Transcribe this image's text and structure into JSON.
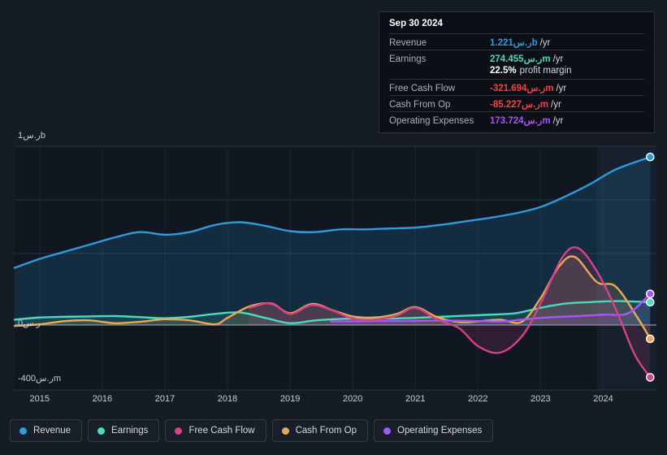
{
  "chart_data": {
    "type": "area",
    "title": "",
    "xlabel": "",
    "ylabel": "",
    "grid": true,
    "legend_position": "bottom",
    "x_ticks": [
      "2015",
      "2016",
      "2017",
      "2018",
      "2019",
      "2020",
      "2021",
      "2022",
      "2023",
      "2024"
    ],
    "y_ticks": [
      "1ر.سb",
      "0ر.س",
      "-400ر.سm"
    ],
    "ylim": [
      -400,
      1000
    ],
    "y_unit": "ر.س (millions)",
    "forecast_band_start": "2024",
    "series": [
      {
        "name": "Revenue",
        "color": "#2e9bdf",
        "fill": "rgba(46,155,223,0.16)",
        "x": [
          2014.6,
          2015.0,
          2015.4,
          2015.8,
          2016.2,
          2016.6,
          2017.0,
          2017.4,
          2017.8,
          2018.2,
          2018.6,
          2019.0,
          2019.4,
          2019.8,
          2020.2,
          2020.6,
          2021.0,
          2021.4,
          2021.8,
          2022.2,
          2022.6,
          2023.0,
          2023.4,
          2023.8,
          2024.2,
          2024.75
        ],
        "values": [
          320,
          370,
          410,
          450,
          490,
          520,
          505,
          520,
          560,
          575,
          555,
          525,
          520,
          535,
          535,
          540,
          545,
          560,
          580,
          600,
          625,
          660,
          720,
          790,
          870,
          940
        ]
      },
      {
        "name": "Earnings",
        "color": "#4bd9c0",
        "fill": "rgba(75,217,192,0.13)",
        "x": [
          2014.6,
          2015.0,
          2015.4,
          2015.8,
          2016.2,
          2016.6,
          2017.0,
          2017.4,
          2017.8,
          2018.2,
          2018.6,
          2019.0,
          2019.4,
          2019.8,
          2020.2,
          2020.6,
          2021.0,
          2021.4,
          2021.8,
          2022.2,
          2022.6,
          2023.0,
          2023.4,
          2023.8,
          2024.2,
          2024.75
        ],
        "values": [
          30,
          42,
          46,
          48,
          50,
          44,
          38,
          46,
          62,
          70,
          40,
          10,
          26,
          34,
          36,
          36,
          40,
          46,
          52,
          58,
          66,
          96,
          120,
          128,
          134,
          128
        ]
      },
      {
        "name": "Free Cash Flow",
        "color": "#d6418a",
        "fill": "rgba(214,65,138,0.16)",
        "x": [
          2018.35,
          2018.7,
          2019.0,
          2019.35,
          2019.7,
          2020.0,
          2020.35,
          2020.7,
          2021.0,
          2021.35,
          2021.7,
          2022.0,
          2022.35,
          2022.7,
          2023.0,
          2023.35,
          2023.6,
          2023.9,
          2024.2,
          2024.5,
          2024.75
        ],
        "values": [
          96,
          122,
          62,
          112,
          78,
          36,
          30,
          52,
          96,
          30,
          -20,
          -130,
          -170,
          -70,
          120,
          380,
          430,
          300,
          90,
          -180,
          -322
        ]
      },
      {
        "name": "Cash From Op",
        "color": "#e8a954",
        "fill": "rgba(232,169,84,0.14)",
        "x": [
          2014.6,
          2015.0,
          2015.4,
          2015.8,
          2016.2,
          2016.6,
          2017.0,
          2017.4,
          2017.8,
          2018.0,
          2018.35,
          2018.7,
          2019.0,
          2019.35,
          2019.7,
          2020.0,
          2020.35,
          2020.7,
          2021.0,
          2021.35,
          2021.7,
          2022.0,
          2022.35,
          2022.7,
          2023.0,
          2023.3,
          2023.55,
          2023.9,
          2024.2,
          2024.55,
          2024.75
        ],
        "values": [
          -6,
          4,
          22,
          26,
          10,
          18,
          32,
          26,
          4,
          40,
          104,
          120,
          66,
          118,
          80,
          48,
          42,
          62,
          100,
          44,
          16,
          20,
          30,
          18,
          150,
          330,
          380,
          240,
          215,
          40,
          -85
        ]
      },
      {
        "name": "Operating Expenses",
        "color": "#a855f7",
        "fill": "rgba(168,85,247,0.12)",
        "x": [
          2019.65,
          2020.0,
          2020.4,
          2020.8,
          2021.2,
          2021.6,
          2022.0,
          2022.4,
          2022.8,
          2023.2,
          2023.6,
          2024.0,
          2024.4,
          2024.75
        ],
        "values": [
          20,
          20,
          22,
          22,
          24,
          24,
          22,
          20,
          34,
          44,
          50,
          58,
          66,
          174
        ]
      }
    ],
    "endpoint_markers": [
      {
        "series": "Revenue",
        "color": "#2e9bdf"
      },
      {
        "series": "Earnings",
        "color": "#4bd9c0"
      },
      {
        "series": "Operating Expenses",
        "color": "#a855f7"
      },
      {
        "series": "Cash From Op",
        "color": "#e8a954"
      },
      {
        "series": "Free Cash Flow",
        "color": "#d6418a"
      }
    ]
  },
  "y_axis": {
    "top_label": "1ر.سb",
    "zero_label": "0ر.س",
    "bottom_label": "-400ر.سm"
  },
  "tooltip": {
    "date": "Sep 30 2024",
    "rows": [
      {
        "label": "Revenue",
        "value": "1.221ر.سb",
        "suffix": "/yr",
        "color": "#2e9bdf",
        "note": ""
      },
      {
        "label": "Earnings",
        "value": "274.455ر.سm",
        "suffix": "/yr",
        "color": "#4bd9c0",
        "note": ""
      },
      {
        "label": "",
        "value": "22.5%",
        "suffix": "",
        "color": "#ffffff",
        "note": "profit margin"
      },
      {
        "label": "Free Cash Flow",
        "value": "-321.694ر.سm",
        "suffix": "/yr",
        "color": "#ef4444",
        "note": ""
      },
      {
        "label": "Cash From Op",
        "value": "-85.227ر.سm",
        "suffix": "/yr",
        "color": "#ef4444",
        "note": ""
      },
      {
        "label": "Operating Expenses",
        "value": "173.724ر.سm",
        "suffix": "/yr",
        "color": "#a855f7",
        "note": ""
      }
    ]
  },
  "legend": {
    "items": [
      {
        "label": "Revenue",
        "color": "#2e9bdf"
      },
      {
        "label": "Earnings",
        "color": "#4bd9c0"
      },
      {
        "label": "Free Cash Flow",
        "color": "#d6418a"
      },
      {
        "label": "Cash From Op",
        "color": "#e8a954"
      },
      {
        "label": "Operating Expenses",
        "color": "#a855f7"
      }
    ]
  },
  "colors": {
    "background": "#151c24",
    "plot_background": "#101721",
    "forecast_band": "#16202c",
    "gridline": "#2a323d",
    "zero_line": "#9aa2ad",
    "panel_background": "#0c1016",
    "panel_border": "#2b323c"
  }
}
